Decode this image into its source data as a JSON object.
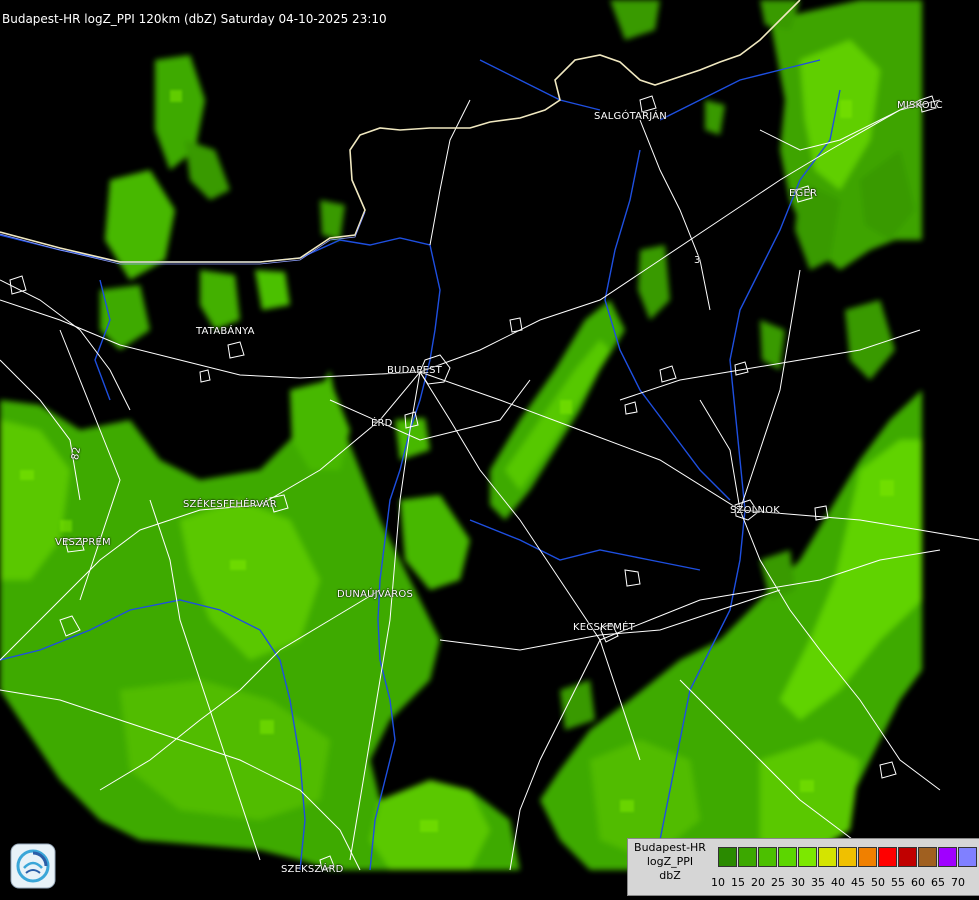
{
  "header": {
    "title": "Budapest-HR logZ_PPI 120km (dbZ) Saturday 04-10-2025 23:10"
  },
  "cities": [
    {
      "key": "salgotarjan",
      "label": "SALGÓTARJÁN"
    },
    {
      "key": "eger",
      "label": "EGER"
    },
    {
      "key": "tatabanya",
      "label": "TATABÁNYA"
    },
    {
      "key": "budapest",
      "label": "BUDAPEST"
    },
    {
      "key": "erd",
      "label": "ÉRD"
    },
    {
      "key": "szekesfehervar",
      "label": "SZÉKESFEHÉRVÁR"
    },
    {
      "key": "veszprem",
      "label": "VESZPRÉM"
    },
    {
      "key": "dunaujvaros",
      "label": "DUNAÚJVÁROS"
    },
    {
      "key": "szolnok",
      "label": "SZOLNOK"
    },
    {
      "key": "kecskemet",
      "label": "KECSKEMÉT"
    },
    {
      "key": "szekszard",
      "label": "SZEKSZÁRD"
    },
    {
      "key": "miskolc",
      "label": "MISKOLC"
    }
  ],
  "road_numbers": [
    "82",
    "3"
  ],
  "legend": {
    "line1": "Budapest-HR",
    "line2": "logZ_PPI",
    "unit": "dbZ",
    "ticks": [
      "10",
      "15",
      "20",
      "25",
      "30",
      "35",
      "40",
      "45",
      "50",
      "55",
      "60",
      "65",
      "70"
    ],
    "colors": [
      "#2a8a00",
      "#3ca800",
      "#4cc000",
      "#5cd600",
      "#7ce800",
      "#d4e400",
      "#f0c000",
      "#f08000",
      "#ff0000",
      "#c00000",
      "#a06020",
      "#a000ff",
      "#8080ff"
    ]
  },
  "colors": {
    "background": "#000000",
    "echo_weak": "#2d8c00",
    "echo_mid": "#4cb800",
    "echo_strong": "#6ee000",
    "rivers": "#1e4fe0",
    "roads": "#ffffff",
    "border": "#f0e8c0"
  },
  "icons": {
    "logo": "weather-service-logo"
  }
}
